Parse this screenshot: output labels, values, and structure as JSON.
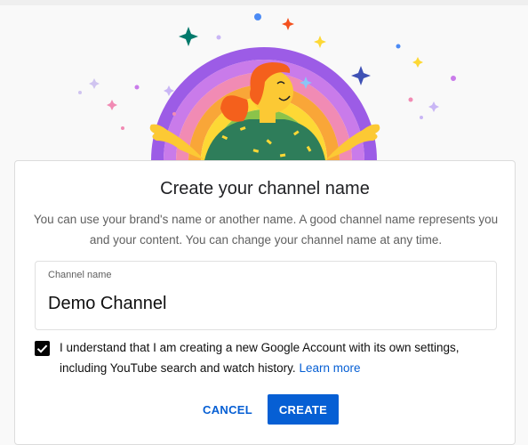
{
  "dialog": {
    "title": "Create your channel name",
    "description": "You can use your brand's name or another name. A good channel name represents you and your content. You can change your channel name at any time.",
    "channel_name_label": "Channel name",
    "channel_name_value": "Demo Channel",
    "consent_checked": true,
    "consent_text": "I understand that I am creating a new Google Account with its own settings, including YouTube search and watch history.",
    "learn_more_label": "Learn more",
    "cancel_label": "CANCEL",
    "create_label": "CREATE"
  },
  "colors": {
    "accent": "#065fd4",
    "text_primary": "#0f0f0f",
    "text_secondary": "#606060",
    "background": "#f9f9f9",
    "rainbow": [
      "#9c5ce6",
      "#c97bea",
      "#f18bb4",
      "#f9a638",
      "#fdd835",
      "#8bc34a",
      "#26a69a",
      "#00796b"
    ],
    "hair": "#f4601c",
    "skin": "#fcc934",
    "shirt": "#2e7d5a"
  },
  "icons": {
    "hero": "channel-illustration",
    "checkbox": "check-icon"
  }
}
